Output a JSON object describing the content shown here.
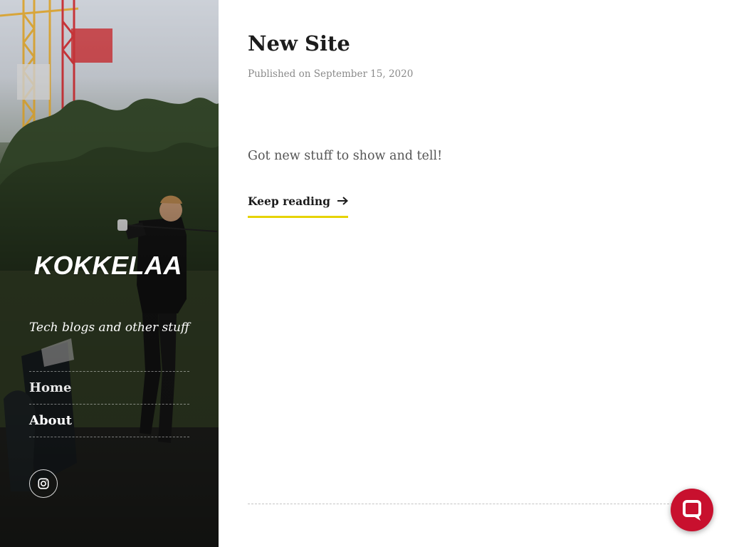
{
  "site": {
    "title": "KOKKELAA",
    "tagline": "Tech blogs and other stuff"
  },
  "nav": {
    "items": [
      {
        "label": "Home"
      },
      {
        "label": "About"
      }
    ]
  },
  "social": {
    "icon": "instagram-icon"
  },
  "post": {
    "title": "New Site",
    "meta": "Published on September 15, 2020",
    "excerpt": "Got new stuff to show and tell!",
    "read_more": "Keep reading",
    "read_more_icon": "arrow-right-icon"
  },
  "chat": {
    "icon": "chat-bubble-icon"
  },
  "colors": {
    "accent_underline": "#e6d300",
    "chat_button": "#c8102e",
    "title_text": "#1c1c1c",
    "meta_text": "#8a8a8a"
  }
}
